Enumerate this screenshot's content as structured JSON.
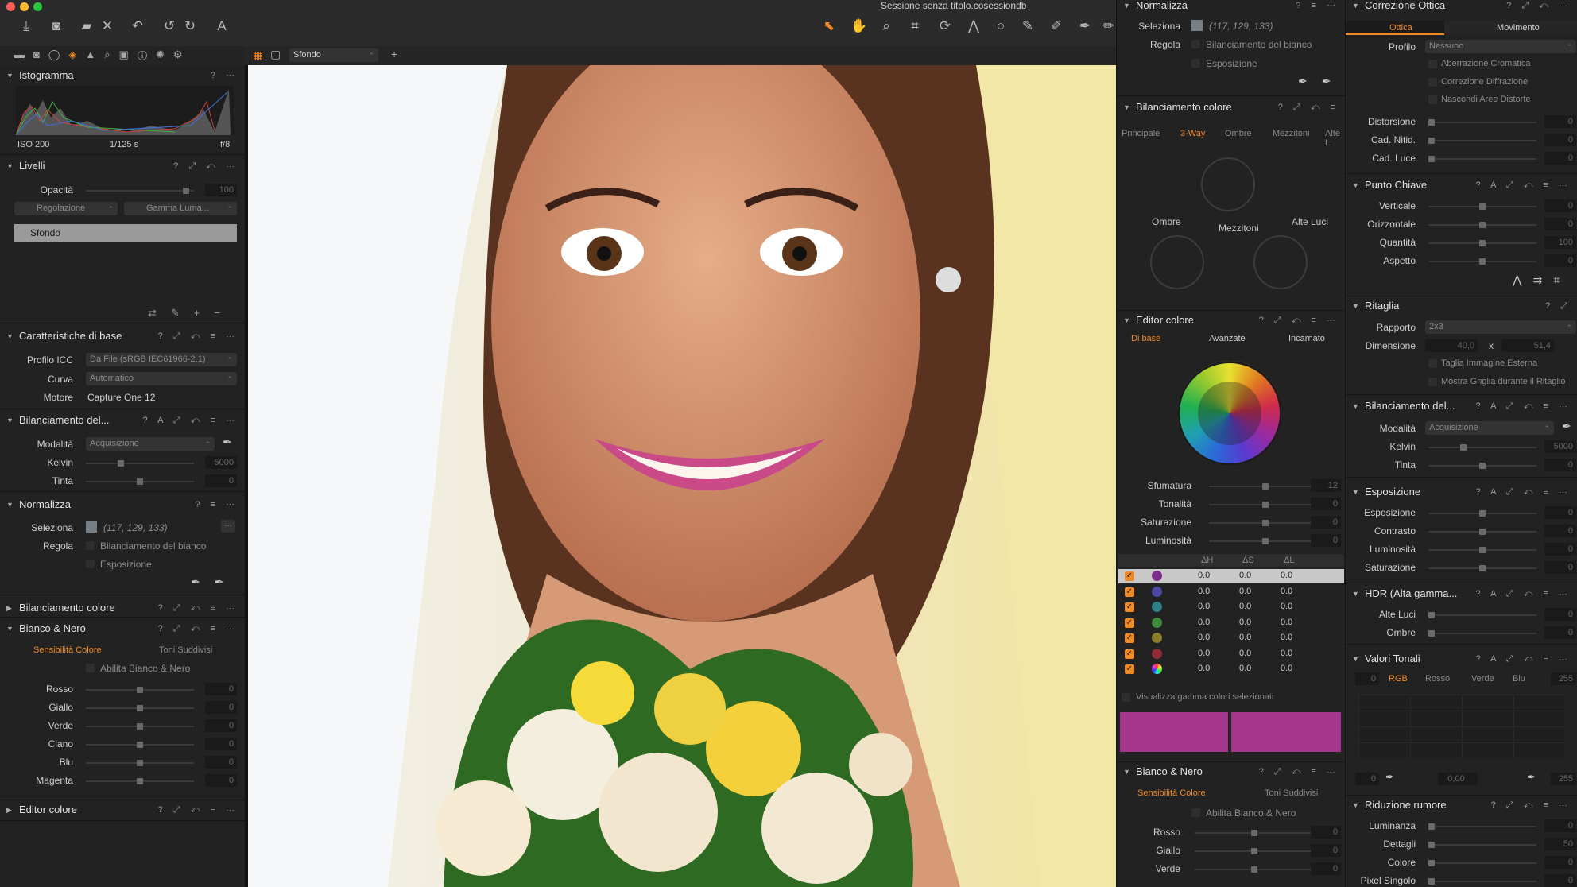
{
  "window": {
    "title": "Sessione senza titolo.cosessiondb",
    "viewer_variant": "Sfondo"
  },
  "colors": {
    "accent": "#f08a24",
    "panel": "#222222",
    "titlebar": "#2b2b2b",
    "swatch": "#a5368e"
  },
  "left": {
    "histogram": {
      "title": "Istogramma",
      "iso": "ISO 200",
      "shutter": "1/125 s",
      "aperture": "f/8"
    },
    "levels": {
      "title": "Livelli",
      "opacity_label": "Opacità",
      "opacity_value": "100",
      "adjust_drop": "Regolazione",
      "gamma_drop": "Gamma Luma...",
      "layer_name": "Sfondo"
    },
    "base": {
      "title": "Caratteristiche di base",
      "icc_label": "Profilo ICC",
      "icc_value": "Da File (sRGB IEC61966-2.1)",
      "curve_label": "Curva",
      "curve_value": "Automatico",
      "engine_label": "Motore",
      "engine_value": "Capture One 12"
    },
    "wb": {
      "title": "Bilanciamento del...",
      "mode_label": "Modalità",
      "mode_value": "Acquisizione",
      "kelvin_label": "Kelvin",
      "kelvin_value": "5000",
      "tint_label": "Tinta",
      "tint_value": "0"
    },
    "normalize": {
      "title": "Normalizza",
      "select_label": "Seleziona",
      "select_value": "(117, 129, 133)",
      "adjust_label": "Regola",
      "wb_check": "Bilanciamento del bianco",
      "exp_check": "Esposizione"
    },
    "colorbal": {
      "title": "Bilanciamento colore"
    },
    "bw": {
      "title": "Bianco & Nero",
      "tab1": "Sensibilità Colore",
      "tab2": "Toni Suddivisi",
      "enable": "Abilita Bianco & Nero",
      "rows": [
        {
          "label": "Rosso",
          "value": "0"
        },
        {
          "label": "Giallo",
          "value": "0"
        },
        {
          "label": "Verde",
          "value": "0"
        },
        {
          "label": "Ciano",
          "value": "0"
        },
        {
          "label": "Blu",
          "value": "0"
        },
        {
          "label": "Magenta",
          "value": "0"
        }
      ]
    },
    "coloreditor": {
      "title": "Editor colore"
    }
  },
  "mid": {
    "normalize": {
      "title": "Normalizza",
      "select_label": "Seleziona",
      "select_value": "(117, 129, 133)",
      "adjust_label": "Regola",
      "wb_check": "Bilanciamento del bianco",
      "exp_check": "Esposizione"
    },
    "colorbal": {
      "title": "Bilanciamento colore",
      "tabs": [
        "Principale",
        "3-Way",
        "Ombre",
        "Mezzitoni",
        "Alte L"
      ],
      "shadows": "Ombre",
      "mids": "Mezzitoni",
      "highlights": "Alte Luci"
    },
    "coloreditor": {
      "title": "Editor colore",
      "tabs": [
        "Di base",
        "Avanzate",
        "Incarnato"
      ],
      "rows": [
        {
          "label": "Sfumatura",
          "value": "12"
        },
        {
          "label": "Tonalità",
          "value": "0"
        },
        {
          "label": "Saturazione",
          "value": "0"
        },
        {
          "label": "Luminosità",
          "value": "0"
        }
      ],
      "col_h": "ΔH",
      "col_s": "ΔS",
      "col_l": "ΔL",
      "dd_rows": [
        {
          "color": "#7a2d8a",
          "h": "0.0",
          "s": "0.0",
          "l": "0.0"
        },
        {
          "color": "#4f49a6",
          "h": "0.0",
          "s": "0.0",
          "l": "0.0"
        },
        {
          "color": "#2f7f86",
          "h": "0.0",
          "s": "0.0",
          "l": "0.0"
        },
        {
          "color": "#3e8b3e",
          "h": "0.0",
          "s": "0.0",
          "l": "0.0"
        },
        {
          "color": "#8a7e2c",
          "h": "0.0",
          "s": "0.0",
          "l": "0.0"
        },
        {
          "color": "#8f2c35",
          "h": "0.0",
          "s": "0.0",
          "l": "0.0"
        },
        {
          "color": "#e0d0e0",
          "h": "0.0",
          "s": "0.0",
          "l": "0.0"
        }
      ],
      "show_gamut": "Visualizza gamma colori selezionati"
    },
    "bw": {
      "title": "Bianco & Nero",
      "tab1": "Sensibilità Colore",
      "tab2": "Toni Suddivisi",
      "enable": "Abilita Bianco & Nero",
      "rows": [
        {
          "label": "Rosso",
          "value": "0"
        },
        {
          "label": "Giallo",
          "value": "0"
        },
        {
          "label": "Verde",
          "value": "0"
        }
      ]
    }
  },
  "right": {
    "optics": {
      "title": "Correzione Ottica",
      "tab1": "Ottica",
      "tab2": "Movimento",
      "profile_label": "Profilo",
      "profile_value": "Nessuno",
      "chk1": "Aberrazione Cromatica",
      "chk2": "Correzione Diffrazione",
      "chk3": "Nascondi Aree Distorte",
      "rows": [
        {
          "label": "Distorsione",
          "value": "0"
        },
        {
          "label": "Cad. Nitid.",
          "value": "0"
        },
        {
          "label": "Cad. Luce",
          "value": "0"
        }
      ]
    },
    "keystone": {
      "title": "Punto Chiave",
      "rows": [
        {
          "label": "Verticale",
          "value": "0"
        },
        {
          "label": "Orizzontale",
          "value": "0"
        },
        {
          "label": "Quantità",
          "value": "100"
        },
        {
          "label": "Aspetto",
          "value": "0"
        }
      ]
    },
    "crop": {
      "title": "Ritaglia",
      "ratio_label": "Rapporto",
      "ratio_value": "2x3",
      "dim_label": "Dimensione",
      "w": "40,0",
      "x": "x",
      "h": "51,4",
      "chk1": "Taglia Immagine Esterna",
      "chk2": "Mostra Griglia durante il Ritaglio"
    },
    "wb": {
      "title": "Bilanciamento del...",
      "mode_label": "Modalità",
      "mode_value": "Acquisizione",
      "kelvin_label": "Kelvin",
      "kelvin_value": "5000",
      "tint_label": "Tinta",
      "tint_value": "0"
    },
    "exposure": {
      "title": "Esposizione",
      "rows": [
        {
          "label": "Esposizione",
          "value": "0"
        },
        {
          "label": "Contrasto",
          "value": "0"
        },
        {
          "label": "Luminosità",
          "value": "0"
        },
        {
          "label": "Saturazione",
          "value": "0"
        }
      ]
    },
    "hdr": {
      "title": "HDR (Alta gamma...",
      "rows": [
        {
          "label": "Alte Luci",
          "value": "0"
        },
        {
          "label": "Ombre",
          "value": "0"
        }
      ]
    },
    "levels": {
      "title": "Valori Tonali",
      "tabs": [
        "RGB",
        "Rosso",
        "Verde",
        "Blu"
      ],
      "low": "0",
      "high": "255",
      "out_low": "0",
      "mid": "0,00",
      "out_high": "255"
    },
    "noise": {
      "title": "Riduzione rumore",
      "rows": [
        {
          "label": "Luminanza",
          "value": "0"
        },
        {
          "label": "Dettagli",
          "value": "50"
        },
        {
          "label": "Colore",
          "value": "0"
        },
        {
          "label": "Pixel Singolo",
          "value": "0"
        }
      ]
    }
  }
}
